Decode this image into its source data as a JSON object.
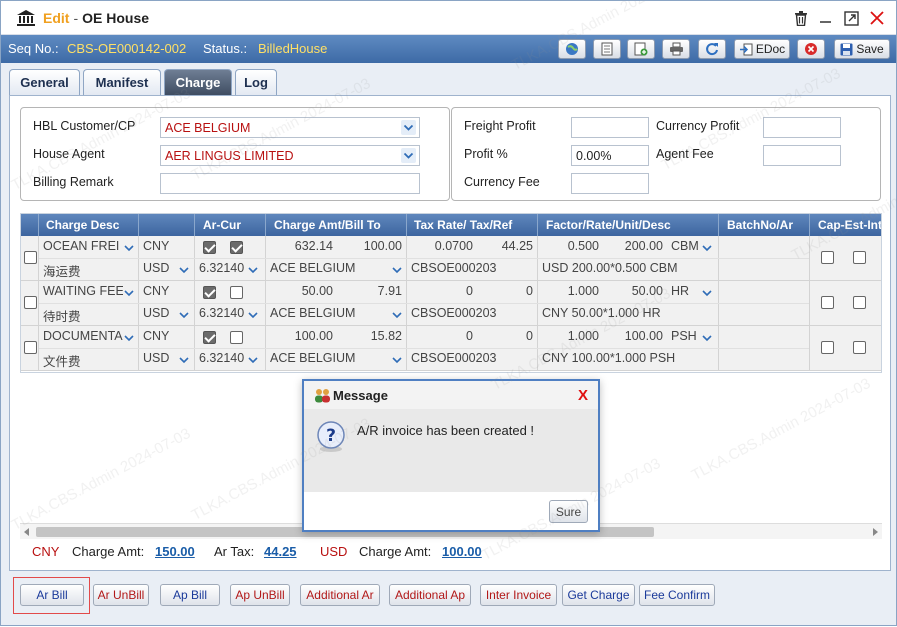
{
  "window": {
    "edit_label": "Edit",
    "title": "OE House"
  },
  "infobar": {
    "seq_label": "Seq No.:",
    "seq_value": "CBS-OE000142-002",
    "status_label": "Status.:",
    "status_value": "BilledHouse",
    "edoc_label": "EDoc",
    "save_label": "Save"
  },
  "tabs": [
    "General",
    "Manifest",
    "Charge",
    "Log"
  ],
  "form": {
    "hbl_label": "HBL Customer/CP",
    "hbl_value": "ACE BELGIUM",
    "agent_label": "House Agent",
    "agent_value": "AER LINGUS LIMITED",
    "remark_label": "Billing Remark",
    "remark_value": "",
    "freight_profit_label": "Freight Profit",
    "freight_profit_value": "",
    "currency_profit_label": "Currency Profit",
    "currency_profit_value": "",
    "profit_pct_label": "Profit %",
    "profit_pct_value": "0.00%",
    "agent_fee_label": "Agent Fee",
    "agent_fee_value": "",
    "currency_fee_label": "Currency Fee",
    "currency_fee_value": ""
  },
  "grid": {
    "headers": [
      "Charge Desc",
      "Ar-Cur",
      "Charge Amt/Bill To",
      "Tax Rate/ Tax/Ref",
      "Factor/Rate/Unit/Desc",
      "BatchNo/Ar",
      "Cap-Est-Int"
    ],
    "rows": [
      {
        "desc": "OCEAN FREI",
        "desc_cn": "海运费",
        "cur": "CNY",
        "ar_cur": "USD",
        "rate": "6.32140",
        "ar_checked": true,
        "est_checked": true,
        "amt": "632.14",
        "amt2": "100.00",
        "bill_to": "ACE BELGIUM",
        "tax_rate": "0.0700",
        "tax": "44.25",
        "ref": "CBSOE000203",
        "factor": "0.500",
        "unit_rate": "200.00",
        "unit": "CBM",
        "desc2": "USD 200.00*0.500 CBM"
      },
      {
        "desc": "WAITING FEE",
        "desc_cn": "待时费",
        "cur": "CNY",
        "ar_cur": "USD",
        "rate": "6.32140",
        "ar_checked": true,
        "est_checked": false,
        "amt": "50.00",
        "amt2": "7.91",
        "bill_to": "ACE BELGIUM",
        "tax_rate": "0",
        "tax": "0",
        "ref": "CBSOE000203",
        "factor": "1.000",
        "unit_rate": "50.00",
        "unit": "HR",
        "desc2": "CNY 50.00*1.000 HR"
      },
      {
        "desc": "DOCUMENTA",
        "desc_cn": "文件费",
        "cur": "CNY",
        "ar_cur": "USD",
        "rate": "6.32140",
        "ar_checked": true,
        "est_checked": false,
        "amt": "100.00",
        "amt2": "15.82",
        "bill_to": "ACE BELGIUM",
        "tax_rate": "0",
        "tax": "0",
        "ref": "CBSOE000203",
        "factor": "1.000",
        "unit_rate": "100.00",
        "unit": "PSH",
        "desc2": "CNY 100.00*1.000 PSH"
      }
    ]
  },
  "totals": {
    "cny_label": "CNY",
    "charge_amt_label": "Charge Amt:",
    "charge_amt": "150.00",
    "ar_tax_label": "Ar Tax:",
    "ar_tax": "44.25",
    "usd_label": "USD",
    "usd_charge_label": "Charge Amt:",
    "usd_charge_amt": "100.00"
  },
  "bottom_buttons": [
    "Ar Bill",
    "Ar UnBill",
    "Ap Bill",
    "Ap UnBill",
    "Additional Ar",
    "Additional Ap",
    "Inter Invoice",
    "Get Charge",
    "Fee Confirm"
  ],
  "dialog": {
    "title": "Message",
    "close": "X",
    "message": "A/R invoice has been created !",
    "ok_label": "Sure"
  },
  "watermark": {
    "user": "TLKA.CBS.Admin",
    "date": "2024-07-03"
  }
}
